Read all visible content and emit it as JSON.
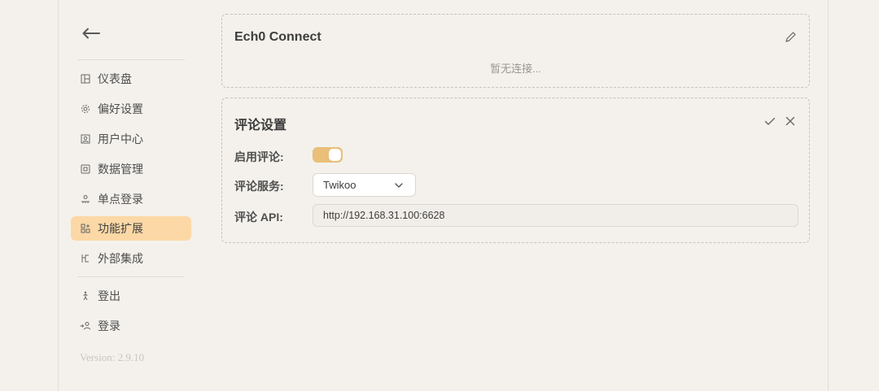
{
  "sidebar": {
    "items": [
      {
        "label": "仪表盘",
        "icon": "dashboard-icon"
      },
      {
        "label": "偏好设置",
        "icon": "gear-icon"
      },
      {
        "label": "用户中心",
        "icon": "user-card-icon"
      },
      {
        "label": "数据管理",
        "icon": "database-icon"
      },
      {
        "label": "单点登录",
        "icon": "key-icon"
      },
      {
        "label": "功能扩展",
        "icon": "apps-icon",
        "active": true
      },
      {
        "label": "外部集成",
        "icon": "branch-icon"
      }
    ],
    "auth_items": [
      {
        "label": "登出",
        "icon": "walk-icon"
      },
      {
        "label": "登录",
        "icon": "login-icon"
      }
    ],
    "version": "Version: 2.9.10"
  },
  "echo_card": {
    "title": "Ech0 Connect",
    "empty_text": "暂无连接..."
  },
  "comment_card": {
    "title": "评论设置",
    "enable_label": "启用评论:",
    "enabled": true,
    "service_label": "评论服务:",
    "service_value": "Twikoo",
    "api_label": "评论 API:",
    "api_value": "http://192.168.31.100:6628"
  },
  "colors": {
    "background": "#f4f1ec",
    "active_nav": "#fcd8a6",
    "toggle_on": "#e9bf7a"
  }
}
